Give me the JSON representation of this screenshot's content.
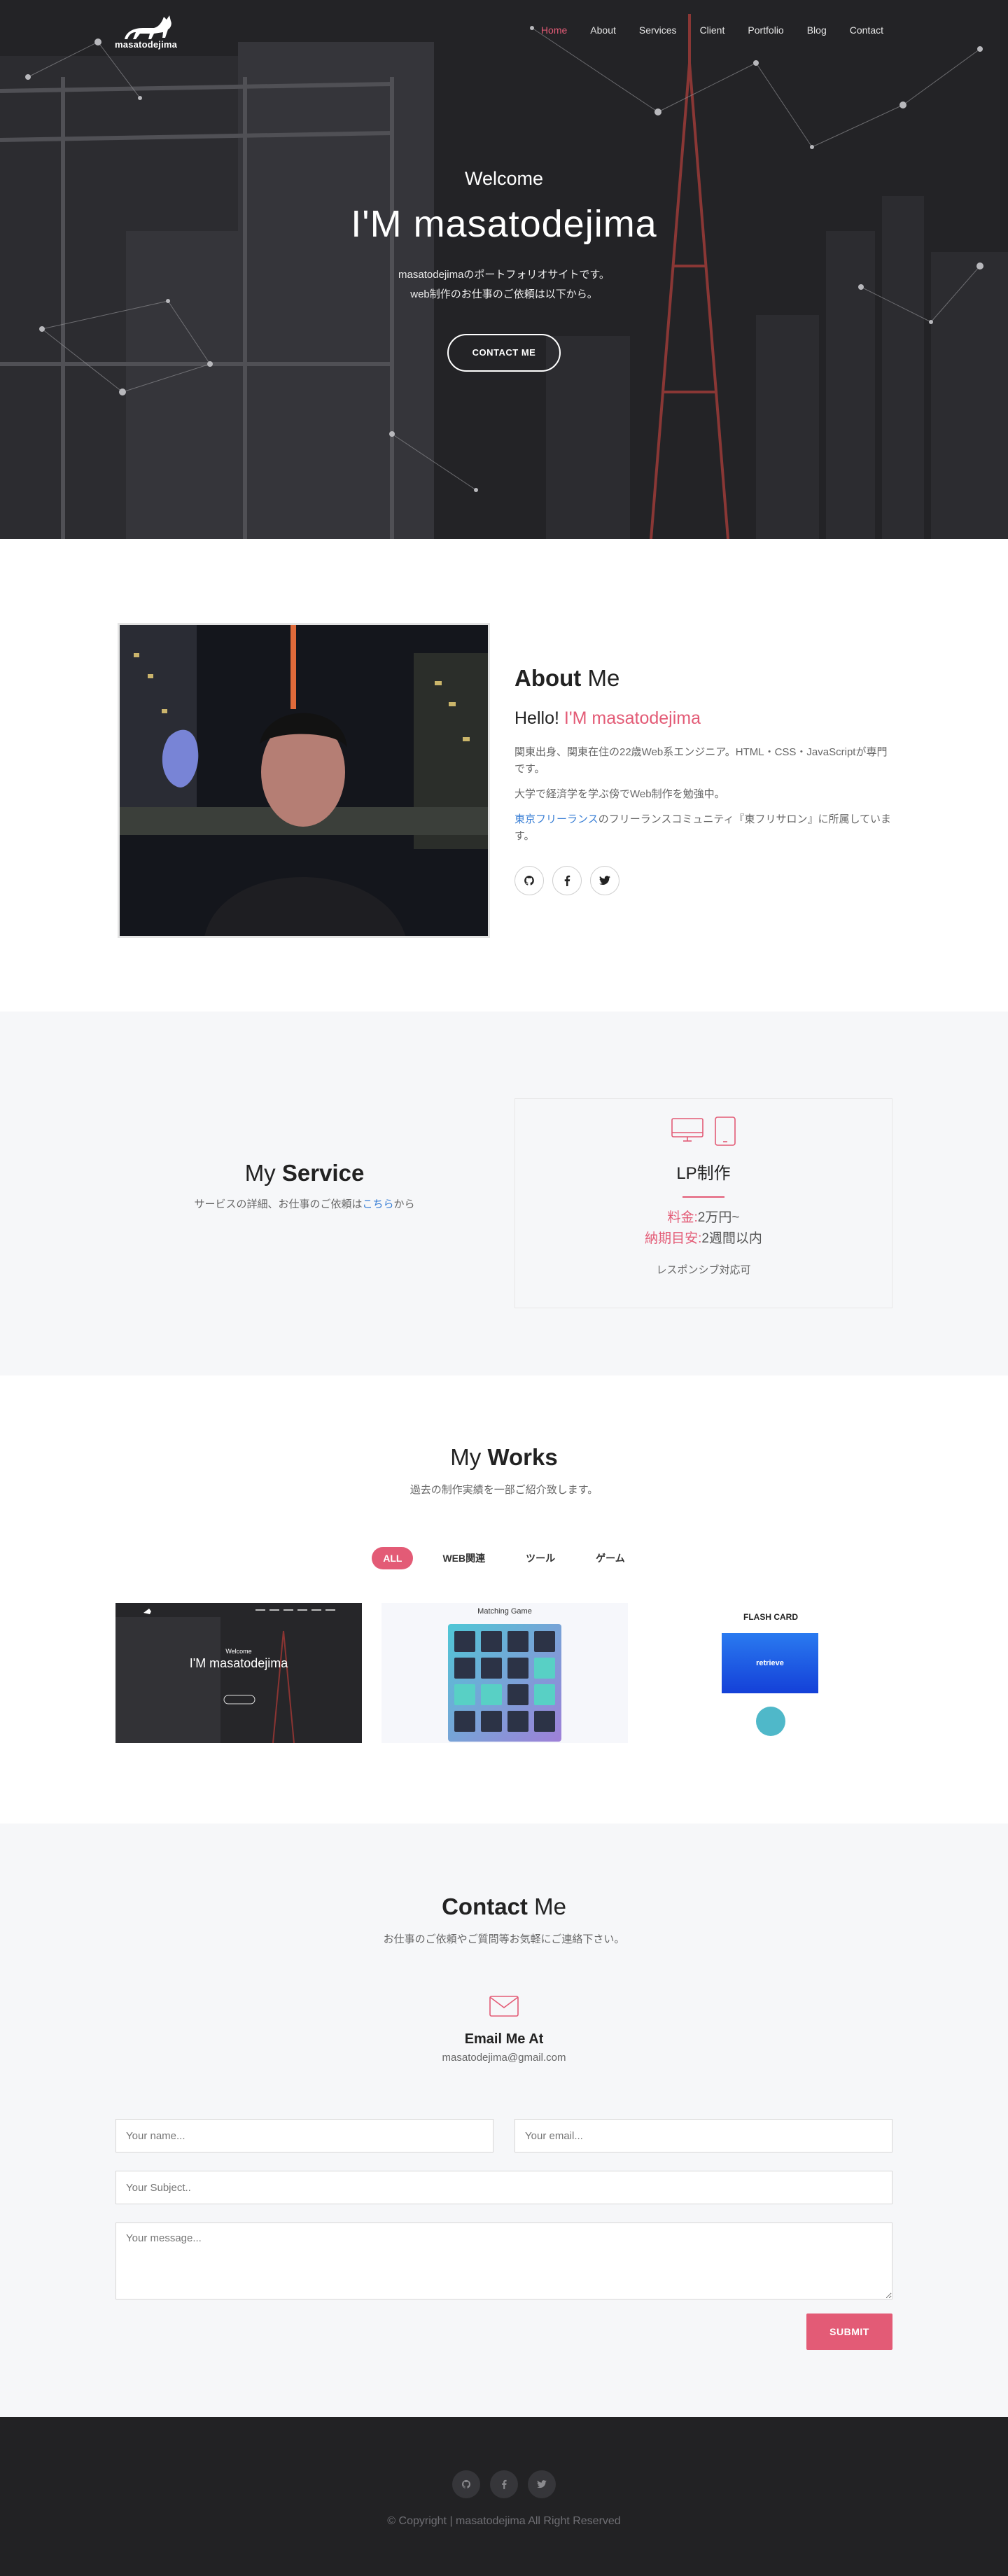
{
  "nav": {
    "logo_text": "masatodejima",
    "items": [
      "Home",
      "About",
      "Services",
      "Client",
      "Portfolio",
      "Blog",
      "Contact"
    ]
  },
  "hero": {
    "welcome": "Welcome",
    "title": "I'M masatodejima",
    "line1": "masatodejimaのポートフォリオサイトです。",
    "line2": "web制作のお仕事のご依頼は以下から。",
    "button": "CONTACT ME"
  },
  "about": {
    "title_a": "About",
    "title_b": " Me",
    "hello": "Hello! ",
    "hello_name": "I'M masatodejima",
    "p1": "関東出身、関東在住の22歳Web系エンジニア。HTML・CSS・JavaScriptが専門です。",
    "p2": "大学で経済学を学ぶ傍でWeb制作を勉強中。",
    "p3_link": "東京フリーランス",
    "p3_rest": "のフリーランスコミュニティ『東フリサロン』に所属しています。",
    "social": [
      "github-icon",
      "facebook-icon",
      "twitter-icon"
    ]
  },
  "service": {
    "title_a": "My ",
    "title_b": "Service",
    "desc_a": "サービスの詳細、お仕事のご依頼は",
    "desc_link": "こちら",
    "desc_b": "から",
    "card": {
      "title": "LP制作",
      "price_label": "料金:",
      "price_value": "2万円~",
      "term_label": "納期目安:",
      "term_value": "2週間以内",
      "note": "レスポンシブ対応可"
    }
  },
  "works": {
    "title_a": "My ",
    "title_b": "Works",
    "subtitle": "過去の制作実績を一部ご紹介致します。",
    "filters": [
      "ALL",
      "WEB関連",
      "ツール",
      "ゲーム"
    ],
    "thumb1": {
      "title": "I'M masatodejima",
      "welcome": "Welcome"
    },
    "thumb2": {
      "title": "Matching Game"
    },
    "thumb3": {
      "title": "FLASH CARD",
      "button": "retrieve"
    }
  },
  "contact": {
    "title_a": "Contact ",
    "title_b": "Me",
    "subtitle": "お仕事のご依頼やご質問等お気軽にご連絡下さい。",
    "email_title": "Email Me At",
    "email": "masatodejima@gmail.com",
    "name_ph": "Your name...",
    "email_ph": "Your email...",
    "subject_ph": "Your Subject..",
    "message_ph": "Your message...",
    "submit": "SUBMIT"
  },
  "footer": {
    "copyright": "© Copyright | masatodejima All Right Reserved"
  },
  "colors": {
    "accent": "#e35b76",
    "link": "#3a7fd5",
    "dark": "#222224",
    "light_bg": "#f6f7f9"
  }
}
